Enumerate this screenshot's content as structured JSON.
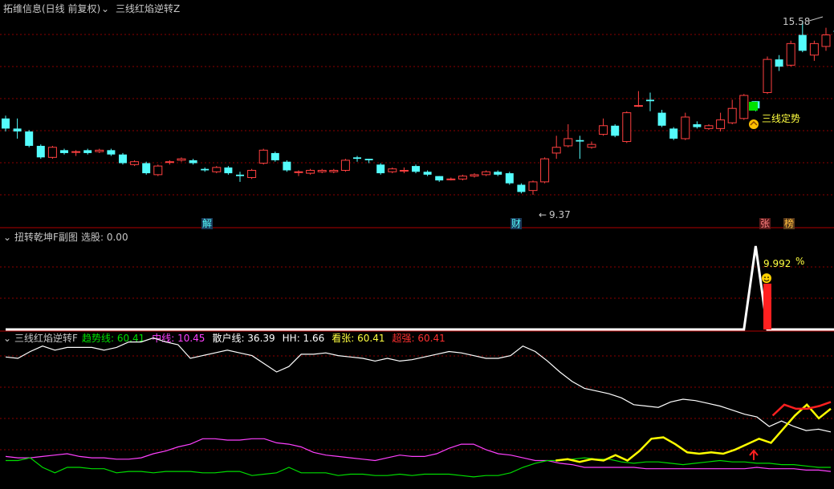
{
  "colors": {
    "background": "#000000",
    "panel_border": "#b00000",
    "grid": "#8b0000",
    "candle_up": "#ff4040",
    "candle_down": "#54fcfc",
    "signal_green": "#00e000",
    "signal_text": "#ffff40",
    "white_line": "#ffffff",
    "magenta": "#ff40ff",
    "green": "#00dd00",
    "yellow": "#ffff00",
    "red": "#ff2020",
    "muted": "#c8c8c8"
  },
  "main_panel": {
    "title": "拓维信息(日线 前复权)",
    "indicator": "三线红焰逆转Z",
    "high_label": "15.58",
    "low_label": "9.37",
    "signal_label": "三线定势",
    "markers": [
      "解",
      "财",
      "张",
      "榜"
    ]
  },
  "sub_panel1": {
    "title": "扭转乾坤F副图",
    "select_label": "选股: 0.00",
    "value_label": "9.992",
    "percent_label": "%"
  },
  "sub_panel2": {
    "title": "三线红焰逆转F",
    "legend": [
      {
        "label": "趋势线: 60.41",
        "color": "#00e000"
      },
      {
        "label": "中线: 10.45",
        "color": "#ff40ff"
      },
      {
        "label": "散户线: 36.39",
        "color": "#ffffff"
      },
      {
        "label": "HH: 1.66",
        "color": "#ffffff"
      },
      {
        "label": "看张: 60.41",
        "color": "#ffff40"
      },
      {
        "label": "超强: 60.41",
        "color": "#ff3030"
      }
    ]
  },
  "chart_data": [
    {
      "type": "candlestick",
      "title": "拓维信息(日线 前复权)",
      "ylim": [
        9.0,
        15.9
      ],
      "series": [
        {
          "values": [
            [
              12.4,
              12.05,
              12.5,
              11.95
            ],
            [
              12.05,
              11.95,
              12.4,
              11.7
            ],
            [
              11.95,
              11.45,
              12.0,
              11.4
            ],
            [
              11.45,
              11.05,
              11.5,
              11.0
            ],
            [
              11.05,
              11.4,
              11.45,
              11.0
            ],
            [
              11.3,
              11.2,
              11.35,
              11.15
            ],
            [
              11.25,
              11.25,
              11.3,
              11.1
            ],
            [
              11.3,
              11.2,
              11.35,
              11.15
            ],
            [
              11.25,
              11.3,
              11.35,
              11.2
            ],
            [
              11.3,
              11.15,
              11.35,
              11.1
            ],
            [
              11.15,
              10.85,
              11.2,
              10.8
            ],
            [
              10.8,
              10.9,
              10.95,
              10.75
            ],
            [
              10.85,
              10.5,
              10.9,
              10.45
            ],
            [
              10.45,
              10.75,
              10.8,
              10.4
            ],
            [
              10.9,
              10.9,
              10.95,
              10.8
            ],
            [
              10.95,
              11.0,
              11.05,
              10.9
            ],
            [
              10.95,
              10.85,
              11.0,
              10.8
            ],
            [
              10.65,
              10.6,
              10.7,
              10.55
            ],
            [
              10.55,
              10.7,
              10.75,
              10.5
            ],
            [
              10.7,
              10.5,
              10.75,
              10.45
            ],
            [
              10.45,
              10.4,
              10.55,
              10.2
            ],
            [
              10.35,
              10.6,
              10.65,
              10.3
            ],
            [
              10.85,
              11.3,
              11.35,
              10.8
            ],
            [
              11.2,
              10.95,
              11.25,
              10.9
            ],
            [
              10.9,
              10.6,
              10.95,
              10.55
            ],
            [
              10.55,
              10.55,
              10.6,
              10.4
            ],
            [
              10.5,
              10.6,
              10.65,
              10.45
            ],
            [
              10.55,
              10.6,
              10.65,
              10.5
            ],
            [
              10.55,
              10.6,
              10.65,
              10.5
            ],
            [
              10.6,
              10.95,
              11.0,
              10.55
            ],
            [
              11.05,
              11.0,
              11.1,
              10.9
            ],
            [
              11.0,
              10.95,
              11.0,
              10.85
            ],
            [
              10.8,
              10.5,
              10.85,
              10.45
            ],
            [
              10.55,
              10.65,
              10.7,
              10.5
            ],
            [
              10.6,
              10.6,
              10.7,
              10.5
            ],
            [
              10.75,
              10.55,
              10.8,
              10.5
            ],
            [
              10.55,
              10.45,
              10.6,
              10.4
            ],
            [
              10.4,
              10.25,
              10.4,
              10.2
            ],
            [
              10.3,
              10.3,
              10.35,
              10.25
            ],
            [
              10.3,
              10.4,
              10.45,
              10.25
            ],
            [
              10.4,
              10.45,
              10.5,
              10.35
            ],
            [
              10.45,
              10.55,
              10.6,
              10.4
            ],
            [
              10.55,
              10.45,
              10.6,
              10.4
            ],
            [
              10.5,
              10.15,
              10.55,
              10.1
            ],
            [
              10.1,
              9.85,
              10.15,
              9.8
            ],
            [
              9.9,
              10.2,
              10.25,
              9.75
            ],
            [
              10.2,
              11.0,
              11.05,
              10.15
            ],
            [
              11.2,
              11.4,
              11.8,
              11.0
            ],
            [
              11.45,
              11.7,
              12.2,
              11.4
            ],
            [
              11.65,
              11.6,
              11.8,
              11.0
            ],
            [
              11.4,
              11.5,
              11.6,
              11.35
            ],
            [
              11.85,
              12.15,
              12.4,
              11.8
            ],
            [
              12.15,
              11.8,
              12.2,
              11.75
            ],
            [
              11.6,
              12.6,
              12.65,
              11.55
            ],
            [
              12.85,
              12.85,
              13.35,
              12.8
            ],
            [
              13.05,
              13.0,
              13.3,
              12.65
            ],
            [
              12.6,
              12.15,
              12.7,
              12.1
            ],
            [
              12.05,
              11.7,
              12.1,
              11.65
            ],
            [
              11.7,
              12.45,
              12.6,
              11.65
            ],
            [
              12.2,
              12.1,
              12.3,
              12.05
            ],
            [
              12.05,
              12.15,
              12.2,
              12.0
            ],
            [
              12.05,
              12.35,
              12.6,
              11.95
            ],
            [
              12.25,
              12.75,
              13.05,
              12.2
            ],
            [
              12.4,
              13.2,
              13.25,
              12.35
            ],
            [
              13.0,
              12.75,
              13.0,
              12.65
            ],
            [
              13.3,
              14.45,
              14.55,
              13.25
            ],
            [
              14.45,
              14.2,
              14.6,
              14.05
            ],
            [
              14.25,
              15.0,
              15.1,
              14.2
            ],
            [
              15.3,
              14.75,
              15.8,
              14.7
            ],
            [
              14.6,
              15.0,
              15.1,
              14.4
            ],
            [
              14.9,
              15.3,
              15.55,
              14.75
            ],
            [
              15.45,
              15.4,
              15.8,
              15.2
            ]
          ]
        }
      ]
    },
    {
      "type": "line",
      "title": "扭转乾坤F副图",
      "ylim": [
        0,
        10
      ],
      "series": [
        {
          "name": "选股",
          "values": [
            0,
            0,
            0,
            0,
            0,
            0,
            0,
            0,
            0,
            0,
            0,
            0,
            0,
            0,
            0,
            0,
            0,
            0,
            0,
            0,
            0,
            0,
            0,
            0,
            0,
            0,
            0,
            0,
            0,
            0,
            0,
            0,
            0,
            0,
            0,
            0,
            0,
            0,
            0,
            0,
            0,
            0,
            0,
            0,
            0,
            0,
            0,
            0,
            0,
            0,
            0,
            0,
            0,
            0,
            0,
            0,
            0,
            0,
            0,
            0,
            0,
            0,
            0,
            0,
            10,
            0,
            0,
            0,
            0,
            0,
            0,
            0,
            0,
            0
          ]
        },
        {
          "name": "bar",
          "values": [
            0,
            0,
            0,
            0,
            0,
            0,
            0,
            0,
            0,
            0,
            0,
            0,
            0,
            0,
            0,
            0,
            0,
            0,
            0,
            0,
            0,
            0,
            0,
            0,
            0,
            0,
            0,
            0,
            0,
            0,
            0,
            0,
            0,
            0,
            0,
            0,
            0,
            0,
            0,
            0,
            0,
            0,
            0,
            0,
            0,
            0,
            0,
            0,
            0,
            0,
            0,
            0,
            0,
            0,
            0,
            0,
            0,
            0,
            0,
            0,
            0,
            0,
            0,
            0,
            0,
            5.5,
            0,
            0,
            0,
            0,
            0,
            0,
            0,
            0
          ]
        }
      ]
    },
    {
      "type": "line",
      "title": "三线红焰逆转F",
      "ylim": [
        0,
        100
      ],
      "series": [
        {
          "name": "散户线",
          "values": [
            91,
            90,
            95,
            99,
            96,
            98,
            98,
            98,
            96,
            98,
            102,
            102,
            105,
            102,
            100,
            90,
            92,
            94,
            96,
            94,
            92,
            86,
            80,
            84,
            93,
            93,
            94,
            92,
            91,
            90,
            88,
            90,
            88,
            89,
            91,
            93,
            95,
            94,
            92,
            90,
            90,
            92,
            99,
            95,
            88,
            80,
            73,
            68,
            66,
            64,
            61,
            56,
            55,
            54,
            58,
            60,
            59,
            57,
            55,
            52,
            49,
            47,
            40,
            44,
            40,
            37,
            38,
            36
          ]
        },
        {
          "name": "中线",
          "values": [
            18,
            17,
            17,
            18,
            19,
            20,
            18,
            17,
            17,
            16,
            16,
            17,
            20,
            22,
            25,
            27,
            31,
            31,
            30,
            30,
            31,
            31,
            28,
            27,
            25,
            21,
            19,
            18,
            17,
            16,
            15,
            17,
            19,
            18,
            18,
            20,
            24,
            27,
            27,
            23,
            20,
            19,
            17,
            15,
            15,
            13,
            12,
            10,
            10,
            10,
            10,
            10,
            9,
            9,
            9,
            9,
            9,
            9,
            9,
            9,
            9,
            10,
            9,
            9,
            9,
            8,
            8,
            7
          ]
        },
        {
          "name": "趋势线",
          "values": [
            15,
            15,
            17,
            10,
            6,
            10,
            10,
            9,
            9,
            6,
            7,
            7,
            6,
            7,
            7,
            7,
            6,
            6,
            7,
            7,
            4,
            5,
            6,
            10,
            6,
            6,
            6,
            4,
            5,
            5,
            4,
            4,
            5,
            4,
            5,
            5,
            5,
            4,
            3,
            4,
            4,
            6,
            10,
            13,
            15,
            15,
            16,
            17,
            16,
            16,
            14,
            13,
            14,
            14,
            13,
            12,
            13,
            14,
            15,
            14,
            14,
            13,
            13,
            12,
            12,
            11,
            10,
            10
          ]
        },
        {
          "name": "看张",
          "values": [
            null,
            null,
            null,
            null,
            null,
            null,
            null,
            null,
            null,
            null,
            null,
            null,
            null,
            null,
            null,
            null,
            null,
            null,
            null,
            null,
            null,
            null,
            null,
            null,
            null,
            null,
            null,
            null,
            null,
            null,
            null,
            null,
            null,
            null,
            null,
            null,
            null,
            null,
            null,
            null,
            null,
            null,
            null,
            null,
            null,
            null,
            15,
            16,
            14,
            16,
            15,
            19,
            15,
            22,
            31,
            32,
            27,
            21,
            20,
            21,
            20,
            23,
            27,
            31,
            28,
            38,
            48,
            56,
            46,
            53
          ]
        },
        {
          "name": "超强",
          "values": [
            null,
            null,
            null,
            null,
            null,
            null,
            null,
            null,
            null,
            null,
            null,
            null,
            null,
            null,
            null,
            null,
            null,
            null,
            null,
            null,
            null,
            null,
            null,
            null,
            null,
            null,
            null,
            null,
            null,
            null,
            null,
            null,
            null,
            null,
            null,
            null,
            null,
            null,
            null,
            null,
            null,
            null,
            null,
            null,
            null,
            null,
            null,
            null,
            null,
            null,
            null,
            null,
            null,
            null,
            null,
            null,
            null,
            null,
            null,
            null,
            null,
            null,
            null,
            null,
            null,
            null,
            48,
            56,
            53,
            53,
            55,
            58
          ]
        }
      ]
    }
  ]
}
